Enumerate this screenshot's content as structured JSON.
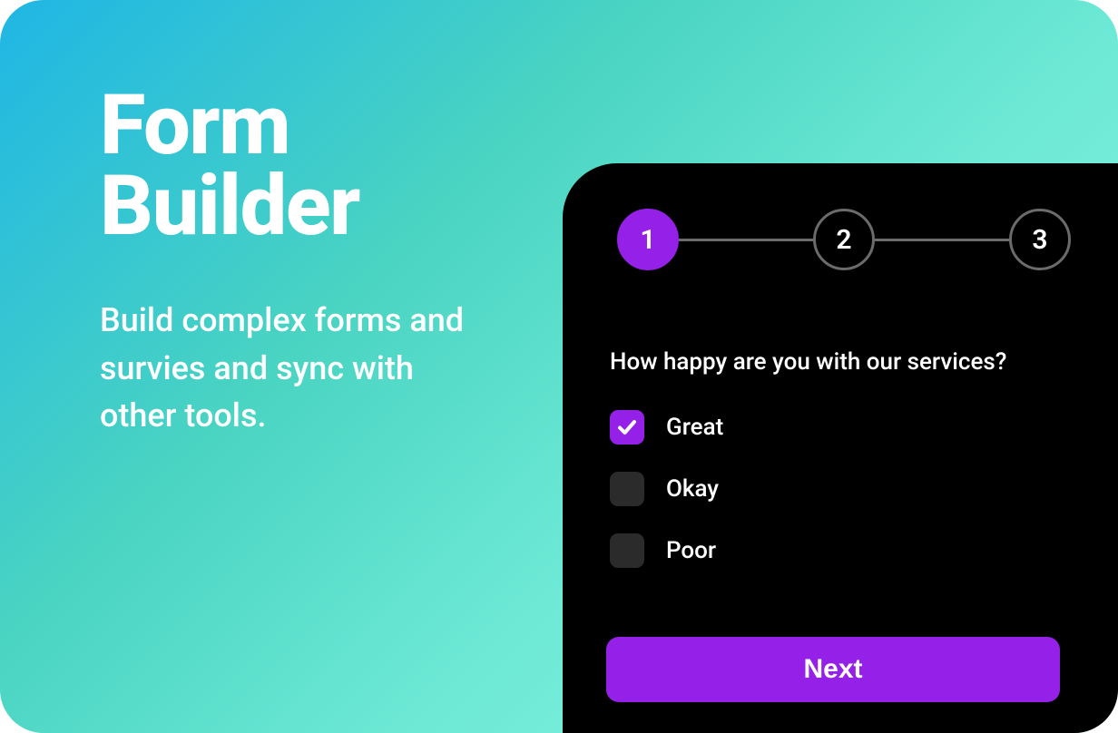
{
  "hero": {
    "title": "Form Builder",
    "subtitle": "Build complex forms and survies and sync with other tools."
  },
  "survey": {
    "steps": [
      "1",
      "2",
      "3"
    ],
    "active_step": 0,
    "question": "How happy are you with our services?",
    "options": [
      {
        "label": "Great",
        "checked": true
      },
      {
        "label": "Okay",
        "checked": false
      },
      {
        "label": "Poor",
        "checked": false
      }
    ],
    "next_label": "Next"
  },
  "colors": {
    "accent": "#9521E8"
  }
}
